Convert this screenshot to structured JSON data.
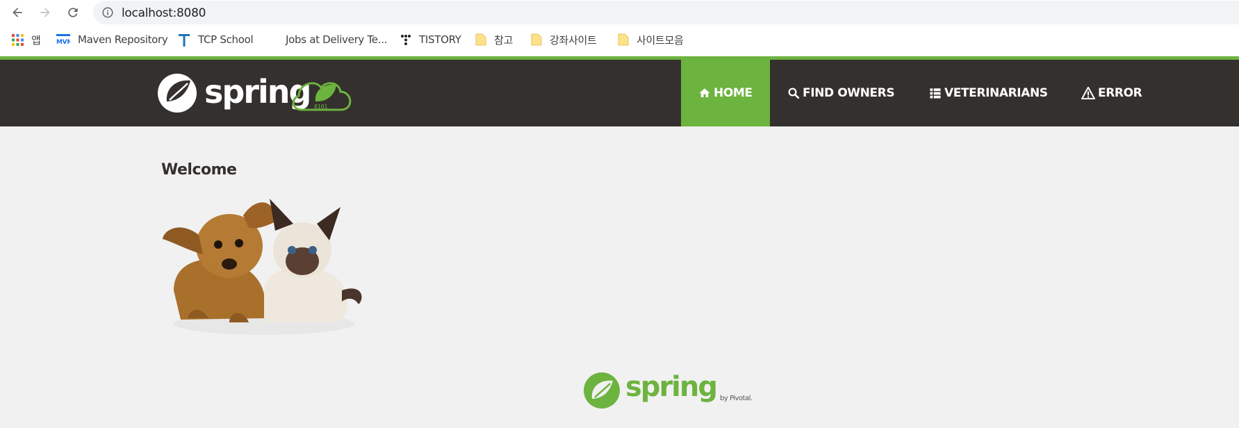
{
  "browser": {
    "url": "localhost:8080",
    "bookmarks": [
      {
        "label": "앱",
        "icon": "apps-grid-icon"
      },
      {
        "label": "Maven Repository",
        "icon": "mvn-icon"
      },
      {
        "label": "TCP School",
        "icon": "tcp-school-icon"
      },
      {
        "label": "Jobs at Delivery Te...",
        "icon": "blank-favicon"
      },
      {
        "label": "TISTORY",
        "icon": "tistory-icon"
      },
      {
        "label": "참고",
        "icon": "folder-icon"
      },
      {
        "label": "강좌사이트",
        "icon": "folder-icon"
      },
      {
        "label": "사이트모음",
        "icon": "folder-icon"
      }
    ]
  },
  "app": {
    "logo_text": "spring",
    "logo_badge": "0101",
    "nav": [
      {
        "label": "HOME",
        "icon": "home-icon",
        "active": true
      },
      {
        "label": "FIND OWNERS",
        "icon": "search-icon",
        "active": false
      },
      {
        "label": "VETERINARIANS",
        "icon": "list-icon",
        "active": false
      },
      {
        "label": "ERROR",
        "icon": "warning-icon",
        "active": false
      }
    ],
    "title": "Welcome",
    "footer_logo_text": "spring",
    "footer_by": "by Pivotal."
  },
  "colors": {
    "spring_green": "#6db33f",
    "navbar_dark": "#34302d",
    "page_bg": "#f1f1f1"
  }
}
